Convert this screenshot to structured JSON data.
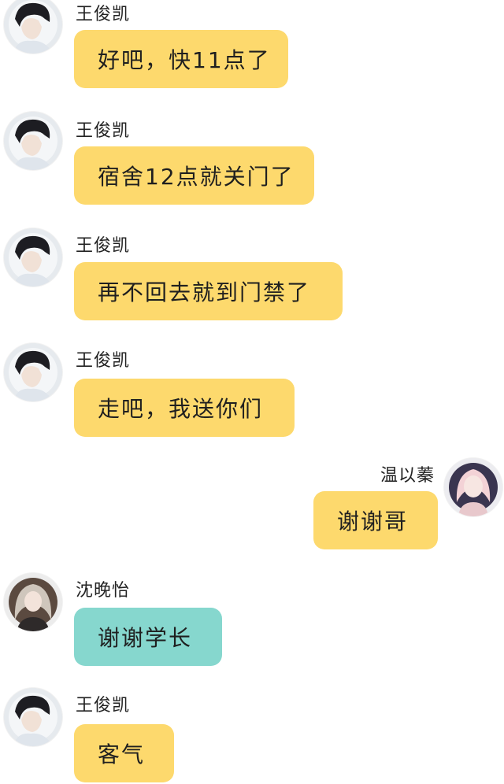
{
  "messages": [
    {
      "sender": "王俊凯",
      "text": "好吧，快11点了",
      "side": "left",
      "color": "#fdd96d",
      "avatar_icon": "boy-avatar-icon"
    },
    {
      "sender": "王俊凯",
      "text": "宿舍12点就关门了",
      "side": "left",
      "color": "#fdd96d",
      "avatar_icon": "boy-avatar-icon"
    },
    {
      "sender": "王俊凯",
      "text": "再不回去就到门禁了",
      "side": "left",
      "color": "#fdd96d",
      "avatar_icon": "boy-avatar-icon"
    },
    {
      "sender": "王俊凯",
      "text": "走吧，我送你们",
      "side": "left",
      "color": "#fdd96d",
      "avatar_icon": "boy-avatar-icon"
    },
    {
      "sender": "温以蓁",
      "text": "谢谢哥",
      "side": "right",
      "color": "#fdd96d",
      "avatar_icon": "girl-pink-avatar-icon"
    },
    {
      "sender": "沈晚怡",
      "text": "谢谢学长",
      "side": "left",
      "color": "#86d7ce",
      "avatar_icon": "girl-avatar-icon"
    },
    {
      "sender": "王俊凯",
      "text": "客气",
      "side": "left",
      "color": "#fdd96d",
      "avatar_icon": "boy-avatar-icon"
    }
  ]
}
